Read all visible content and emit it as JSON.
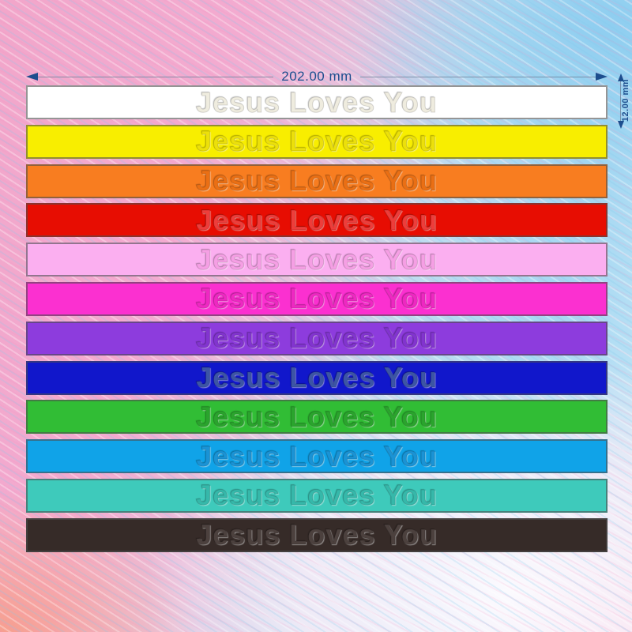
{
  "product": {
    "design_text": "Jesus Loves You"
  },
  "dimensions": {
    "width_label": "202.00 mm",
    "height_label": "12.00 mm",
    "annotation_color": "#1d4e8e"
  },
  "bands": [
    {
      "name": "white",
      "label": "Jesus Loves You",
      "color": "#ffffff",
      "text_color": "#efecdf"
    },
    {
      "name": "yellow",
      "label": "Jesus Loves You",
      "color": "#f8ee00",
      "text_color": "#ece00a"
    },
    {
      "name": "orange",
      "label": "Jesus Loves You",
      "color": "#f87d20",
      "text_color": "#ea6f14"
    },
    {
      "name": "red",
      "label": "Jesus Loves You",
      "color": "#e70d02",
      "text_color": "#ee3d3a"
    },
    {
      "name": "pink",
      "label": "Jesus Loves You",
      "color": "#fbaff0",
      "text_color": "#f59fe4"
    },
    {
      "name": "magenta",
      "label": "Jesus Loves You",
      "color": "#fb30d0",
      "text_color": "#ee28c2"
    },
    {
      "name": "purple",
      "label": "Jesus Loves You",
      "color": "#8d3cdd",
      "text_color": "#8234cf"
    },
    {
      "name": "blue",
      "label": "Jesus Loves You",
      "color": "#1117cb",
      "text_color": "#3c55a5"
    },
    {
      "name": "green",
      "label": "Jesus Loves You",
      "color": "#31bd35",
      "text_color": "#2aa42d"
    },
    {
      "name": "sky-blue",
      "label": "Jesus Loves You",
      "color": "#10a3e8",
      "text_color": "#1a93d5"
    },
    {
      "name": "teal",
      "label": "Jesus Loves You",
      "color": "#3ecabb",
      "text_color": "#36b8aa"
    },
    {
      "name": "black",
      "label": "Jesus Loves You",
      "color": "#362b28",
      "text_color": "#4c413e"
    }
  ]
}
